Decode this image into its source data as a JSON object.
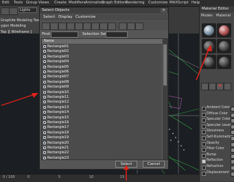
{
  "menubar": {
    "items": [
      "Edit",
      "Tools",
      "Group",
      "Views",
      "Create",
      "Modifiers",
      "Animation",
      "Graph Editors",
      "Rendering",
      "Customize",
      "MAXScript",
      "Help"
    ]
  },
  "left_toolbar": {
    "lights_combo": "Lights",
    "ribbon_title": "Graphite Modeling Tools",
    "ribbon_sub": "ygon Modeling",
    "viewport_label": "Top ][ Wireframe ]"
  },
  "dialog": {
    "title": "Select Objects",
    "close_glyph": "✕",
    "menu": [
      "Select",
      "Display",
      "Customize"
    ],
    "find_label": "Find:",
    "find_value": "",
    "selection_set_label": "Selection Set:",
    "selection_set_value": "",
    "column_header": "Name",
    "rows": [
      "Rectangle01",
      "Rectangle02",
      "Rectangle03",
      "Rectangle04",
      "Rectangle05",
      "Rectangle06",
      "Rectangle07",
      "Rectangle08",
      "Rectangle09",
      "Rectangle10",
      "Rectangle11",
      "Rectangle12",
      "Rectangle13",
      "Rectangle14",
      "Rectangle15",
      "Rectangle16",
      "Rectangle17",
      "Rectangle18",
      "Rectangle19",
      "Rectangle20",
      "Rectangle21",
      "Rectangle22",
      "Rectangle23"
    ],
    "select_button": "Select",
    "cancel_button": "Cancel"
  },
  "material_editor": {
    "title": "Material Editor",
    "menu": [
      "Modes",
      "Material"
    ],
    "params": [
      "Ambient Color",
      "Diffuse Color",
      "Specular Color",
      "Specular Level",
      "Glossiness",
      "Self-Illumination",
      "Opacity",
      "Filter Color",
      "Bump",
      "Reflection",
      "Refraction",
      "Displacement"
    ],
    "checked_param": "Reflection"
  },
  "timeline": {
    "left_label": "0 / 100",
    "ticks": [
      "0",
      "5",
      "10",
      "15"
    ]
  },
  "colors": {
    "annotation_arrow": "#e0231a",
    "selection_row": "#4b4b4b"
  }
}
